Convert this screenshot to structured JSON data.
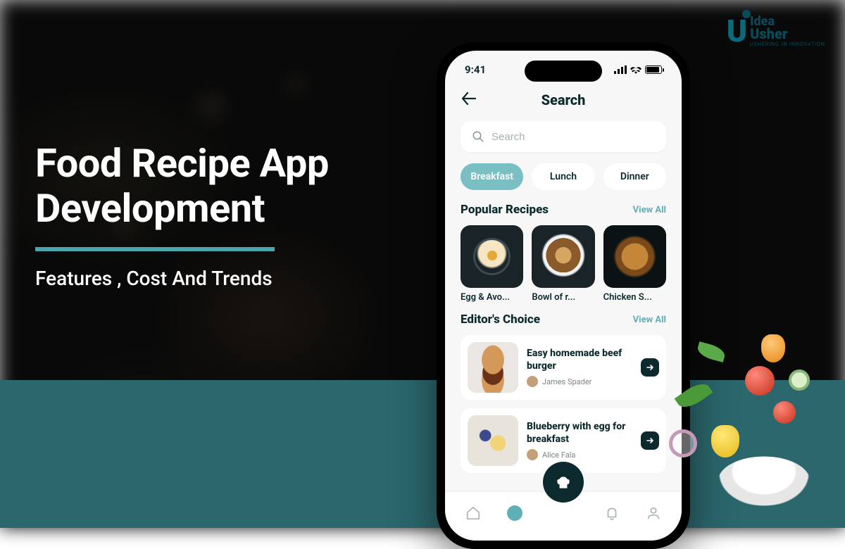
{
  "hero": {
    "title_line1": "Food Recipe App",
    "title_line2": "Development",
    "subtitle": "Features , Cost And Trends"
  },
  "logo": {
    "line1": "Idea",
    "line2": "Usher",
    "tagline": "USHERING IN INNOVATION"
  },
  "phone": {
    "statusbar": {
      "time": "9:41"
    },
    "appbar": {
      "title": "Search"
    },
    "search": {
      "placeholder": "Search"
    },
    "chips": [
      {
        "label": "Breakfast",
        "active": true
      },
      {
        "label": "Lunch",
        "active": false
      },
      {
        "label": "Dinner",
        "active": false
      }
    ],
    "popular": {
      "title": "Popular Recipes",
      "view_all": "View All",
      "items": [
        {
          "label": "Egg & Avo..."
        },
        {
          "label": "Bowl of r..."
        },
        {
          "label": "Chicken S..."
        }
      ]
    },
    "editors": {
      "title": "Editor's Choice",
      "view_all": "View All",
      "items": [
        {
          "title": "Easy homemade beef burger",
          "author": "James Spader"
        },
        {
          "title": "Blueberry with egg for breakfast",
          "author": "Alice Fala"
        }
      ]
    }
  }
}
